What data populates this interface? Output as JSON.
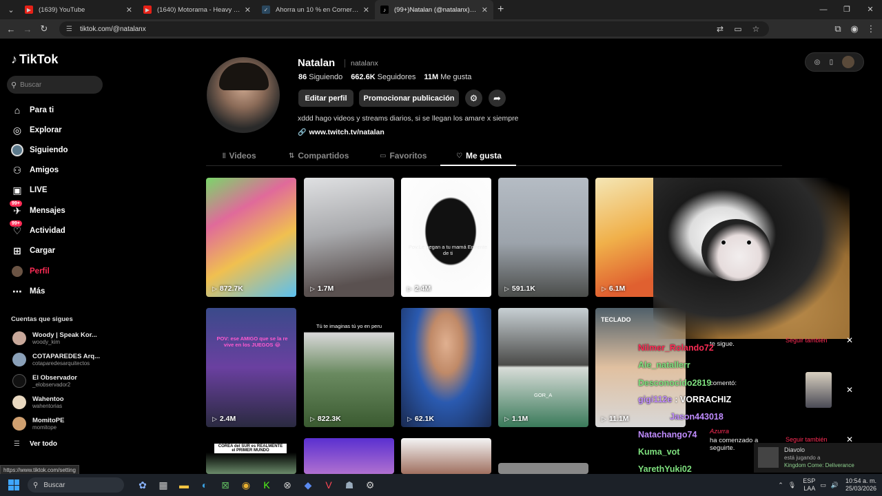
{
  "browser": {
    "tabs": [
      {
        "title": "(1639) YouTube",
        "icon": "youtube-icon",
        "active": false
      },
      {
        "title": "(1640) Motorama - Heavy Wave",
        "icon": "youtube-icon",
        "active": false
      },
      {
        "title": "Ahorra un 10 % en Corner Shop",
        "icon": "steam-icon",
        "active": false
      },
      {
        "title": "(99+)Natalan (@natalanx) | TikT",
        "icon": "tiktok-icon",
        "active": true
      }
    ],
    "url": "tiktok.com/@natalanx",
    "status_url": "https://www.tiktok.com/setting"
  },
  "sidebar": {
    "logo": "TikTok",
    "search_placeholder": "Buscar",
    "nav": [
      {
        "label": "Para ti",
        "icon": "home-icon"
      },
      {
        "label": "Explorar",
        "icon": "compass-icon"
      },
      {
        "label": "Siguiendo",
        "icon": "following-avatar-icon"
      },
      {
        "label": "Amigos",
        "icon": "friends-icon"
      },
      {
        "label": "LIVE",
        "icon": "live-icon"
      },
      {
        "label": "Mensajes",
        "icon": "messages-icon",
        "badge": "99+"
      },
      {
        "label": "Actividad",
        "icon": "activity-icon",
        "badge": "99+"
      },
      {
        "label": "Cargar",
        "icon": "upload-icon"
      },
      {
        "label": "Perfil",
        "icon": "profile-avatar-icon"
      },
      {
        "label": "Más",
        "icon": "more-icon"
      }
    ],
    "following_heading": "Cuentas que sigues",
    "following": [
      {
        "name": "Woody | Speak Kor...",
        "handle": "woody_kim"
      },
      {
        "name": "COTAPAREDES Arq...",
        "handle": "cotaparedesarquitectos"
      },
      {
        "name": "El Observador",
        "handle": "_elobservador2"
      },
      {
        "name": "Wahentoo",
        "handle": "wahentorias"
      },
      {
        "name": "MomitoPE",
        "handle": "momitope"
      }
    ],
    "see_all": "Ver todo"
  },
  "profile": {
    "name": "Natalan",
    "handle": "natalanx",
    "following_count": "86",
    "following_label": "Siguiendo",
    "followers_count": "662.6K",
    "followers_label": "Seguidores",
    "likes_count": "11M",
    "likes_label": "Me gusta",
    "edit_button": "Editar perfil",
    "promote_button": "Promocionar publicación",
    "bio": "xddd hago videos y streams diarios, si se llegan los amare x siempre",
    "link": "www.twitch.tv/natalan"
  },
  "tabs": [
    {
      "label": "Videos",
      "icon": "grid-icon"
    },
    {
      "label": "Compartidos",
      "icon": "repost-icon"
    },
    {
      "label": "Favoritos",
      "icon": "bookmark-icon"
    },
    {
      "label": "Me gusta",
      "icon": "heart-icon"
    }
  ],
  "videos": [
    {
      "views": "872.7K",
      "caption": ""
    },
    {
      "views": "1.7M",
      "caption": ""
    },
    {
      "views": "2.4M",
      "caption": "Pov:Le pegan a tu mamá Enfrente de ti"
    },
    {
      "views": "591.1K",
      "caption": ""
    },
    {
      "views": "6.1M",
      "caption": ""
    },
    {
      "views": "",
      "caption": ""
    },
    {
      "views": "2.4M",
      "caption": "POV: ese AMIGO que se la re vive en los JUEGOS 😂"
    },
    {
      "views": "822.3K",
      "caption": "Tú te imaginas tú yo en peru"
    },
    {
      "views": "62.1K",
      "caption": ""
    },
    {
      "views": "1.1M",
      "caption": "GOR_A"
    },
    {
      "views": "11.1M",
      "caption": "TECLADO"
    },
    {
      "views": "",
      "caption": "COREA del SUR es REALMENTE el PRIMER MUNDO"
    }
  ],
  "overlay": {
    "chat": [
      {
        "user": "Nilmer_Rolando72",
        "msg": "",
        "color": "#fe2c55"
      },
      {
        "user": "Ale_natallerr",
        "msg": "",
        "color": "#7ee07e"
      },
      {
        "user": "Desconocido2819",
        "msg": "",
        "color": "#7ee07e"
      },
      {
        "user": "gigi112e",
        "msg": "VORRACHIZ",
        "color": "#c08cff"
      },
      {
        "user": "Jason443018",
        "msg": "",
        "color": "#c08cff"
      },
      {
        "user": "Natachango74",
        "msg": "",
        "color": "#c08cff"
      },
      {
        "user": "Kuma_vot",
        "msg": "",
        "color": "#7ee07e"
      },
      {
        "user": "YarethYuki02",
        "msg": "",
        "color": "#7ee07e"
      }
    ],
    "notif1_text": "te sigue.",
    "notif1_follow": "Seguir también",
    "notif2_text": "comentó:",
    "notif3_user": "Azurra",
    "notif3_text": "ha comenzado a seguirte.",
    "notif3_follow": "Seguir también",
    "xbox_user": "Diavolo",
    "xbox_status": "está jugando a",
    "xbox_game": "Kingdom Come: Deliverance"
  },
  "taskbar": {
    "search": "Buscar",
    "lang": "ESP",
    "lang2": "LAA",
    "time": "10:54 a. m.",
    "date": "25/03/2026"
  }
}
